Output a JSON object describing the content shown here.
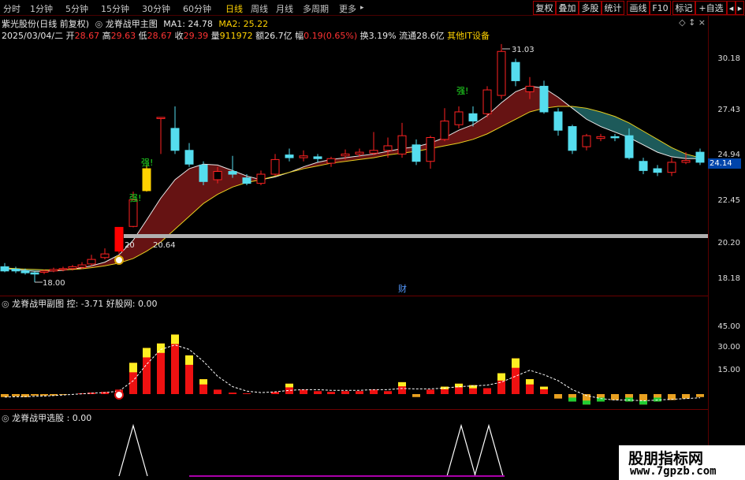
{
  "toolbar": {
    "tabs": [
      "分时",
      "1分钟",
      "5分钟",
      "15分钟",
      "30分钟",
      "60分钟",
      "日线",
      "周线",
      "月线",
      "多周期",
      "更多"
    ],
    "more_arrow": "▸",
    "right_buttons": [
      "复权",
      "叠加",
      "多股",
      "统计",
      "画线",
      "F10",
      "标记",
      "+自选",
      "◂",
      "▸"
    ]
  },
  "header": {
    "stock": "紫光股份(日线 前复权)",
    "indicator": "龙脊战甲主图",
    "ma1": "MA1: 24.78",
    "ma2": "MA2: 25.22",
    "date": "2025/03/04/二",
    "open_label": "开",
    "open": "28.67",
    "high_label": "高",
    "high": "29.63",
    "low_label": "低",
    "low": "28.67",
    "close_label": "收",
    "close": "29.39",
    "vol_label": "量",
    "vol": "911972",
    "amount_label": "额",
    "amount": "26.7亿",
    "change_label": "幅",
    "change": "0.19(0.65%)",
    "turnover_label": "换",
    "turnover": "3.19%",
    "float_label": "流通",
    "float": "28.6亿",
    "sector": "其他IT设备",
    "icons": "◇ ↕ ×"
  },
  "main_chart": {
    "price_axis": [
      "30.18",
      "27.43",
      "24.94",
      "22.45",
      "20.20",
      "18.18"
    ],
    "current_price": "24.14",
    "annot_high": "31.03",
    "annot_low": "18.00",
    "annot_mid": "20.64",
    "annot_mid2": "20",
    "strong_label": "强!",
    "cai_label": "财",
    "up_color": "#ff2222",
    "down_color": "#55ddee"
  },
  "sub_chart": {
    "title": "龙脊战甲副图 控: -3.71 好股网: 0.00",
    "axis": [
      "45.00",
      "30.00",
      "15.00"
    ]
  },
  "select_chart": {
    "title": "龙脊战甲选股 : 0.00"
  },
  "watermark": {
    "line1": "股朋指标网",
    "line2": "www.7gpzb.com"
  },
  "chart_data": {
    "type": "candlestick",
    "title": "",
    "xlabel": "",
    "ylabel": "",
    "ylim": [
      17.5,
      31.5
    ],
    "candles": [
      {
        "x": 6,
        "o": 18.85,
        "c": 18.62,
        "h": 19.05,
        "l": 18.55
      },
      {
        "x": 20,
        "o": 18.72,
        "c": 18.62,
        "h": 18.85,
        "l": 18.5
      },
      {
        "x": 32,
        "o": 18.62,
        "c": 18.52,
        "h": 18.75,
        "l": 18.42
      },
      {
        "x": 44,
        "o": 18.52,
        "c": 18.45,
        "h": 18.6,
        "l": 18.0
      },
      {
        "x": 56,
        "o": 18.55,
        "c": 18.62,
        "h": 18.7,
        "l": 18.45
      },
      {
        "x": 68,
        "o": 18.62,
        "c": 18.7,
        "h": 18.8,
        "l": 18.55
      },
      {
        "x": 80,
        "o": 18.7,
        "c": 18.75,
        "h": 18.85,
        "l": 18.6
      },
      {
        "x": 92,
        "o": 18.75,
        "c": 18.85,
        "h": 18.95,
        "l": 18.65
      },
      {
        "x": 104,
        "o": 18.82,
        "c": 18.95,
        "h": 19.1,
        "l": 18.72
      },
      {
        "x": 116,
        "o": 19.0,
        "c": 19.25,
        "h": 19.5,
        "l": 18.9
      },
      {
        "x": 133,
        "o": 19.35,
        "c": 19.55,
        "h": 19.85,
        "l": 19.25
      },
      {
        "x": 151,
        "o": 19.7,
        "c": 21.0,
        "h": 21.0,
        "l": 19.55
      },
      {
        "x": 169,
        "o": 21.05,
        "c": 22.5,
        "h": 22.95,
        "l": 21.0
      },
      {
        "x": 186,
        "o": 23.0,
        "c": 24.2,
        "h": 24.4,
        "l": 22.95
      },
      {
        "x": 204,
        "o": 27.0,
        "c": 27.0,
        "h": 27.0,
        "l": 25.0
      },
      {
        "x": 222,
        "o": 26.4,
        "c": 25.2,
        "h": 27.6,
        "l": 25.0
      },
      {
        "x": 240,
        "o": 25.2,
        "c": 24.45,
        "h": 25.6,
        "l": 24.3
      },
      {
        "x": 258,
        "o": 24.4,
        "c": 23.5,
        "h": 24.6,
        "l": 23.3
      },
      {
        "x": 276,
        "o": 23.6,
        "c": 24.05,
        "h": 24.3,
        "l": 23.4
      },
      {
        "x": 295,
        "o": 24.05,
        "c": 23.9,
        "h": 24.9,
        "l": 23.7
      },
      {
        "x": 313,
        "o": 23.7,
        "c": 23.4,
        "h": 23.9,
        "l": 23.3
      },
      {
        "x": 331,
        "o": 23.4,
        "c": 23.9,
        "h": 24.1,
        "l": 23.3
      },
      {
        "x": 349,
        "o": 23.9,
        "c": 24.7,
        "h": 25.0,
        "l": 23.8
      },
      {
        "x": 367,
        "o": 24.95,
        "c": 24.8,
        "h": 25.3,
        "l": 24.6
      },
      {
        "x": 385,
        "o": 24.8,
        "c": 24.9,
        "h": 25.2,
        "l": 24.6
      },
      {
        "x": 403,
        "o": 24.85,
        "c": 24.75,
        "h": 25.0,
        "l": 24.55
      },
      {
        "x": 420,
        "o": 24.5,
        "c": 24.75,
        "h": 24.85,
        "l": 24.3
      },
      {
        "x": 438,
        "o": 24.9,
        "c": 25.0,
        "h": 25.25,
        "l": 24.7
      },
      {
        "x": 456,
        "o": 25.0,
        "c": 25.1,
        "h": 25.3,
        "l": 24.85
      },
      {
        "x": 474,
        "o": 25.05,
        "c": 25.2,
        "h": 26.2,
        "l": 24.95
      },
      {
        "x": 492,
        "o": 25.2,
        "c": 25.45,
        "h": 25.9,
        "l": 24.8
      },
      {
        "x": 510,
        "o": 25.0,
        "c": 26.0,
        "h": 26.7,
        "l": 24.8
      },
      {
        "x": 528,
        "o": 25.5,
        "c": 24.6,
        "h": 25.8,
        "l": 24.4
      },
      {
        "x": 546,
        "o": 24.6,
        "c": 25.9,
        "h": 26.0,
        "l": 24.2
      },
      {
        "x": 564,
        "o": 25.8,
        "c": 26.8,
        "h": 27.5,
        "l": 25.7
      },
      {
        "x": 582,
        "o": 26.6,
        "c": 27.3,
        "h": 27.6,
        "l": 26.4
      },
      {
        "x": 600,
        "o": 27.2,
        "c": 26.8,
        "h": 27.6,
        "l": 26.5
      },
      {
        "x": 618,
        "o": 27.2,
        "c": 28.5,
        "h": 28.7,
        "l": 27.0
      },
      {
        "x": 636,
        "o": 28.2,
        "c": 30.6,
        "h": 31.0,
        "l": 28.0
      },
      {
        "x": 654,
        "o": 30.0,
        "c": 29.0,
        "h": 30.2,
        "l": 28.7
      },
      {
        "x": 672,
        "o": 28.4,
        "c": 28.7,
        "h": 29.2,
        "l": 28.0
      },
      {
        "x": 690,
        "o": 28.7,
        "c": 27.3,
        "h": 29.0,
        "l": 27.2
      },
      {
        "x": 708,
        "o": 27.3,
        "c": 26.3,
        "h": 27.5,
        "l": 26.0
      },
      {
        "x": 726,
        "o": 26.5,
        "c": 25.2,
        "h": 26.6,
        "l": 25.0
      },
      {
        "x": 744,
        "o": 25.4,
        "c": 26.0,
        "h": 26.1,
        "l": 25.2
      },
      {
        "x": 762,
        "o": 25.85,
        "c": 25.95,
        "h": 26.1,
        "l": 25.7
      },
      {
        "x": 780,
        "o": 25.95,
        "c": 25.9,
        "h": 26.1,
        "l": 25.7
      },
      {
        "x": 798,
        "o": 26.0,
        "c": 24.8,
        "h": 26.4,
        "l": 24.7
      },
      {
        "x": 816,
        "o": 24.6,
        "c": 24.1,
        "h": 24.8,
        "l": 23.9
      },
      {
        "x": 834,
        "o": 24.2,
        "c": 24.0,
        "h": 24.4,
        "l": 23.8
      },
      {
        "x": 852,
        "o": 24.0,
        "c": 24.55,
        "h": 24.8,
        "l": 23.8
      },
      {
        "x": 870,
        "o": 24.55,
        "c": 24.65,
        "h": 25.1,
        "l": 24.45
      },
      {
        "x": 888,
        "o": 25.1,
        "c": 24.55,
        "h": 25.3,
        "l": 24.4
      }
    ],
    "ma_fast": [
      18.75,
      18.7,
      18.65,
      18.6,
      18.6,
      18.62,
      18.66,
      18.72,
      18.8,
      18.9,
      19.1,
      19.5,
      20.3,
      21.4,
      22.6,
      23.6,
      24.2,
      24.45,
      24.4,
      24.1,
      23.8,
      23.6,
      23.75,
      24.0,
      24.3,
      24.55,
      24.7,
      24.8,
      24.9,
      25.0,
      25.15,
      25.3,
      25.4,
      25.6,
      25.9,
      26.3,
      26.6,
      27.1,
      27.8,
      28.4,
      28.7,
      28.6,
      28.1,
      27.5,
      26.9,
      26.5,
      26.2,
      25.9,
      25.5,
      25.1,
      24.85,
      24.75,
      24.75
    ],
    "ma_slow": [
      18.78,
      18.75,
      18.72,
      18.7,
      18.68,
      18.67,
      18.68,
      18.7,
      18.74,
      18.8,
      18.9,
      19.05,
      19.3,
      19.7,
      20.2,
      20.9,
      21.6,
      22.3,
      22.8,
      23.2,
      23.45,
      23.6,
      23.8,
      24.0,
      24.2,
      24.35,
      24.5,
      24.6,
      24.7,
      24.8,
      24.95,
      25.05,
      25.15,
      25.3,
      25.45,
      25.6,
      25.8,
      26.1,
      26.5,
      26.9,
      27.3,
      27.5,
      27.6,
      27.6,
      27.5,
      27.3,
      27.05,
      26.7,
      26.25,
      25.8,
      25.35,
      25.0,
      24.8
    ],
    "sub_values": [
      -2,
      -1.5,
      -2,
      -1,
      -1,
      -1,
      -0.5,
      0,
      0.5,
      1,
      1.5,
      3,
      21,
      31,
      34,
      40,
      26,
      10,
      3,
      1,
      0.5,
      0,
      1.5,
      7,
      3,
      2,
      1.5,
      2,
      2,
      3,
      2,
      8,
      -2,
      3,
      5,
      7,
      6,
      4,
      14,
      24,
      10,
      5,
      -3,
      -5,
      -7,
      -5,
      -4,
      -5,
      -7,
      -5,
      -4,
      -3,
      -2
    ],
    "sub_line": [
      -2,
      -1.8,
      -1.7,
      -1.5,
      -1.3,
      -1,
      -0.6,
      -0.2,
      0.2,
      0.6,
      1,
      2,
      9,
      20,
      30,
      33,
      30,
      22,
      12,
      5,
      2,
      1,
      1.5,
      2.5,
      3,
      3,
      2.5,
      2.5,
      2.5,
      3,
      3,
      3.8,
      3.5,
      3.5,
      4,
      5,
      5.5,
      6,
      8,
      12,
      16,
      13,
      9,
      3,
      -1,
      -3,
      -4,
      -4,
      -4.5,
      -4,
      -3.5,
      -3,
      -2.5
    ],
    "sub_ylim": [
      -8,
      48
    ],
    "spikes": [
      169,
      585,
      620
    ]
  }
}
